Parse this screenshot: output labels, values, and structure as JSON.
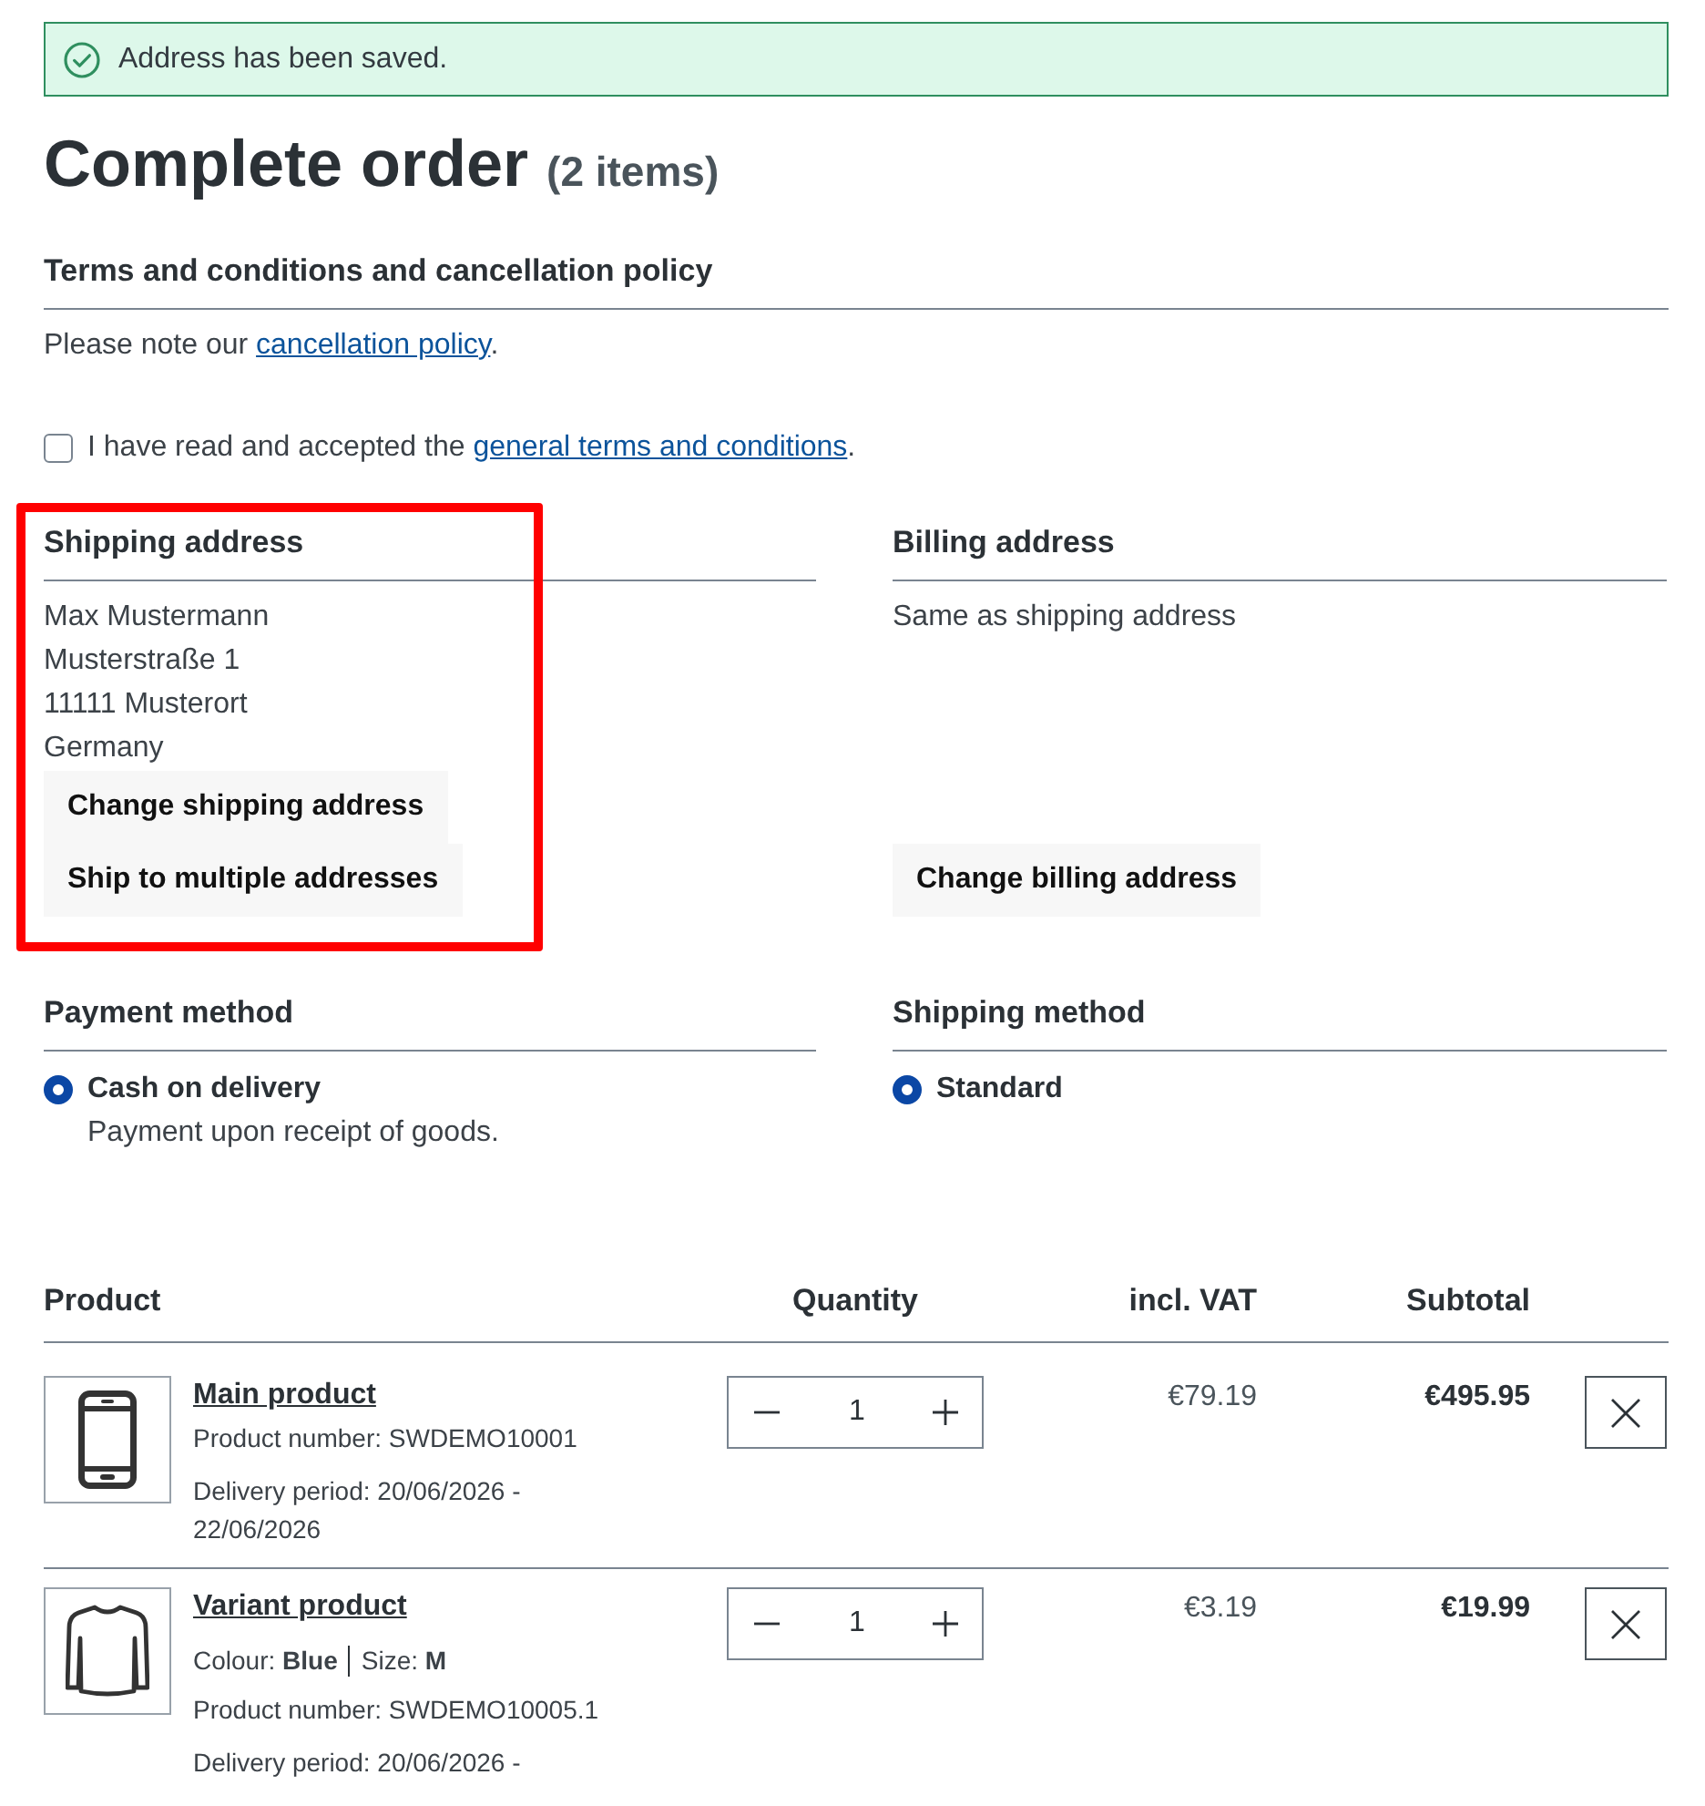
{
  "alert": {
    "kind": "success",
    "message": "Address has been saved."
  },
  "page_heading": {
    "title": "Complete order",
    "count": "(2 items)"
  },
  "terms": {
    "heading": "Terms and conditions and cancellation policy",
    "note": {
      "before": "Please note our ",
      "link": "cancellation policy",
      "after": "."
    },
    "agreement": {
      "checked": false,
      "before": "I have read and accepted the ",
      "link": "general terms and conditions",
      "after": "."
    }
  },
  "shipping_address": {
    "heading": "Shipping address",
    "highlighted": true,
    "lines": [
      "Max Mustermann",
      "Musterstraße 1",
      "11111 Musterort",
      "Germany"
    ],
    "buttons": [
      "Change shipping address",
      "Ship to multiple addresses"
    ]
  },
  "billing_address": {
    "heading": "Billing address",
    "lines": [
      "Same as shipping address"
    ],
    "buttons": [
      "Change billing address"
    ]
  },
  "payment_method": {
    "heading": "Payment method",
    "options": [
      {
        "label": "Cash on delivery",
        "description": "Payment upon receipt of goods.",
        "selected": true
      }
    ]
  },
  "shipping_method": {
    "heading": "Shipping method",
    "options": [
      {
        "label": "Standard",
        "selected": true
      }
    ]
  },
  "cart": {
    "columns": [
      "Product",
      "Quantity",
      "incl. VAT",
      "Subtotal"
    ],
    "rows": [
      {
        "name": "Main product",
        "product_number": "Product number: SWDEMO10001",
        "delivery": "Delivery period: 20/06/2026 - 22/06/2026",
        "quantity": "1",
        "unit_price": "€79.19",
        "subtotal": "€495.95"
      },
      {
        "name": "Variant product",
        "variant": [
          "Colour: **Blue**",
          "Size: **M**"
        ],
        "product_number": "Product number: SWDEMO10005.1",
        "delivery": "Delivery period: 20/06/2026 -",
        "quantity": "1",
        "unit_price": "€3.19",
        "subtotal": "€19.99"
      }
    ]
  }
}
